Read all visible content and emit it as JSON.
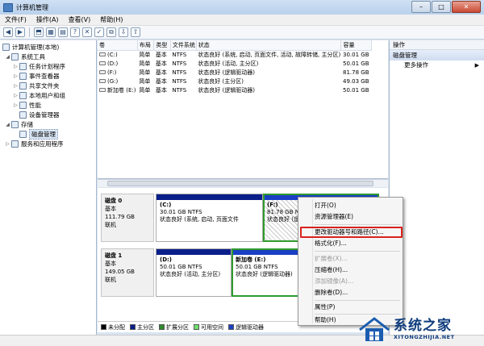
{
  "window": {
    "title": "计算机管理",
    "min": "–",
    "max": "□",
    "close": "✕"
  },
  "menu": [
    "文件(F)",
    "操作(A)",
    "查看(V)",
    "帮助(H)"
  ],
  "toolbar_icons": [
    "back-arrow-icon",
    "forward-arrow-icon",
    "up-folder-icon",
    "show-tree-icon",
    "properties-icon",
    "help-icon",
    "delete-icon",
    "check-icon",
    "folder-open-icon",
    "import-icon",
    "export-icon"
  ],
  "toolbar_glyphs": [
    "◀",
    "▶",
    "⬒",
    "▦",
    "▤",
    "?",
    "✕",
    "✓",
    "⧉",
    "⇩",
    "⇧"
  ],
  "tree": {
    "root": "计算机管理(本地)",
    "system_tools": "系统工具",
    "task_scheduler": "任务计划程序",
    "event_viewer": "事件查看器",
    "shared_folders": "共享文件夹",
    "local_users": "本地用户和组",
    "performance": "性能",
    "device_manager": "设备管理器",
    "storage": "存储",
    "disk_management": "磁盘管理",
    "services": "服务和应用程序"
  },
  "list": {
    "headers": [
      "卷",
      "布局",
      "类型",
      "文件系统",
      "状态",
      "容量"
    ],
    "rows": [
      [
        "(C:)",
        "简单",
        "基本",
        "NTFS",
        "状态良好 (系统, 启动, 页面文件, 活动, 故障转储, 主分区)",
        "30.01 GB"
      ],
      [
        "(D:)",
        "简单",
        "基本",
        "NTFS",
        "状态良好 (活动, 主分区)",
        "50.01 GB"
      ],
      [
        "(F:)",
        "简单",
        "基本",
        "NTFS",
        "状态良好 (逻辑驱动器)",
        "81.78 GB"
      ],
      [
        "(G:)",
        "简单",
        "基本",
        "NTFS",
        "状态良好 (主分区)",
        "49.03 GB"
      ],
      [
        "新加卷 (E:)",
        "简单",
        "基本",
        "NTFS",
        "状态良好 (逻辑驱动器)",
        "50.01 GB"
      ]
    ]
  },
  "disks": [
    {
      "name": "磁盘 0",
      "type": "基本",
      "size": "111.79 GB",
      "status": "联机",
      "parts": [
        {
          "name": "(C:)",
          "info": "30.01 GB NTFS",
          "status": "状态良好 (系统, 启动, 页面文件"
        },
        {
          "name": "(F:)",
          "info": "81.78 GB N",
          "status": "状态良好 (逻"
        }
      ]
    },
    {
      "name": "磁盘 1",
      "type": "基本",
      "size": "149.05 GB",
      "status": "联机",
      "parts": [
        {
          "name": "(D:)",
          "info": "50.01 GB NTFS",
          "status": "状态良好 (活动, 主分区)"
        },
        {
          "name": "新加卷 (E:)",
          "info": "50.01 GB NTFS",
          "status": "状态良好 (逻辑驱动器)"
        }
      ]
    }
  ],
  "legend": [
    {
      "label": "未分配",
      "color": "#000000"
    },
    {
      "label": "主分区",
      "color": "#0b1f8a"
    },
    {
      "label": "扩展分区",
      "color": "#2e8b2e"
    },
    {
      "label": "可用空间",
      "color": "#6fe06f"
    },
    {
      "label": "逻辑驱动器",
      "color": "#1a3fc4"
    }
  ],
  "actions": {
    "header": "操作",
    "section": "磁盘管理",
    "more": "更多操作",
    "arrow": "▶"
  },
  "context_menu": {
    "open": "打开(O)",
    "explorer": "资源管理器(E)",
    "change_letter": "更改驱动器号和路径(C)...",
    "format": "格式化(F)...",
    "extend": "扩展卷(X)...",
    "shrink": "压缩卷(H)...",
    "mirror": "添加镜像(A)...",
    "delete": "删除卷(D)...",
    "properties": "属性(P)",
    "help": "帮助(H)"
  },
  "watermark": {
    "main": "系统之家",
    "url": "XITONGZHIJIA.NET"
  }
}
